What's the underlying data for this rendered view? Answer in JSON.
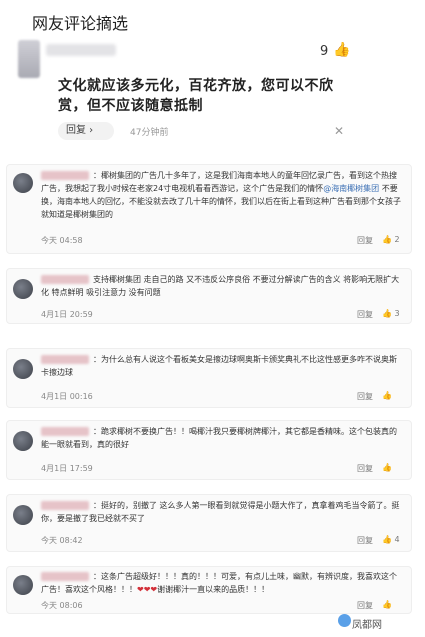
{
  "page": {
    "title": "网友评论摘选"
  },
  "top_comment": {
    "likes": "9",
    "like_icon": "👍",
    "text": "文化就应该多元化，百花齐放，您可以不欣赏，但不应该随意抵制",
    "reply_label": "回复 ›",
    "time": "47分钟前",
    "close_glyph": "✕"
  },
  "comments": [
    {
      "text_a": "：椰树集团的广告几十多年了，这是我们海南本地人的童年回忆录广告，看到这个热搜广告，我想起了我小时候在老家24寸电视机看看西游记，这个广告是我们的情怀",
      "link": "@海南椰树集团",
      "text_b": " 不要换，海南本地人的回忆，不能",
      "text_c": "没就去改了几十年的情怀，我们以后在街上看到这种广告看到那个女孩子就知道是椰树集团的",
      "time": "今天 04:58",
      "reply": "回复",
      "likes": "2"
    },
    {
      "text_a": "支持椰树集团 走自己的路 又不违反公序良俗 不要过分解读广告的含义 将影响无限扩大化 特点鲜明 吸引注意力 没有问题",
      "time": "4月1日 20:59",
      "reply": "回复",
      "likes": "3"
    },
    {
      "text_a": "：为什么总有人说这个看板美女是擦边球啊",
      "text_b": "奥斯卡颁奖典礼不比这性感更多咋不说奥斯卡擦边球",
      "time": "4月1日 00:16",
      "reply": "回复",
      "likes": ""
    },
    {
      "text_a": "：跪求椰树不要换广告！！喝椰汁我只要椰树牌椰汁，其它都是香精味。这个包装真的能一眼就看到，真的很好",
      "time": "4月1日 17:59",
      "reply": "回复",
      "likes": ""
    },
    {
      "text_a": "：挺好的，别撤了 这么多人第一眼看到就觉得是小题大作了，真拿着鸡毛当令箭了。挺你，要是撤了我已经就不买了",
      "time": "今天 08:42",
      "reply": "回复",
      "likes": "4"
    },
    {
      "text_a": "：这条广告超级好！！！真的！！！可爱，有点儿土味，幽默，有辨识度，我喜欢这个广告！喜欢这个风格！！！",
      "hearts": "❤❤❤",
      "text_b": "谢谢椰汁一直以来的品质！！！",
      "time": "今天 08:06",
      "reply": "回复",
      "likes": ""
    }
  ],
  "watermark": "凤都网"
}
